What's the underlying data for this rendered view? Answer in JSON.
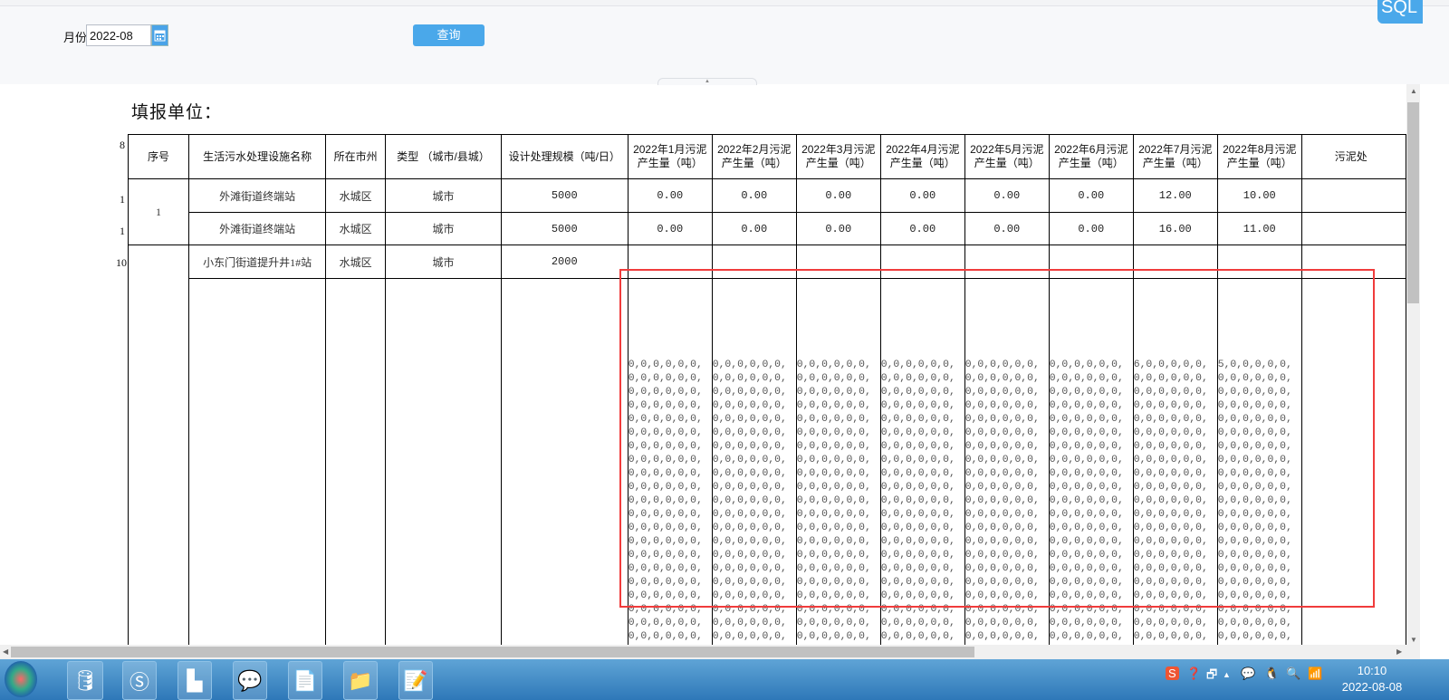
{
  "filter": {
    "month_label": "月份",
    "month_value": "2022-08",
    "query_label": "查询",
    "sql_label": "SQL"
  },
  "report": {
    "title": "填报单位："
  },
  "row_numbers": [
    "8",
    "1",
    "1",
    "10"
  ],
  "table": {
    "headers": [
      "序号",
      "生活污水处理设施名称",
      "所在市州",
      "类型 （城市/县城）",
      "设计处理规模（吨/日）",
      "2022年1月污泥产生量（吨）",
      "2022年2月污泥产生量（吨）",
      "2022年3月污泥产生量（吨）",
      "2022年4月污泥产生量（吨）",
      "2022年5月污泥产生量（吨）",
      "2022年6月污泥产生量（吨）",
      "2022年7月污泥产生量（吨）",
      "2022年8月污泥产生量（吨）",
      "污泥处"
    ],
    "group_seq": "1",
    "rows": [
      {
        "name": "外滩街道终端站",
        "city": "水城区",
        "type": "城市",
        "scale": "5000",
        "months": [
          "0.00",
          "0.00",
          "0.00",
          "0.00",
          "0.00",
          "0.00",
          "12.00",
          "10.00"
        ]
      },
      {
        "name": "外滩街道终端站",
        "city": "水城区",
        "type": "城市",
        "scale": "5000",
        "months": [
          "0.00",
          "0.00",
          "0.00",
          "0.00",
          "0.00",
          "0.00",
          "16.00",
          "11.00"
        ]
      },
      {
        "name": "小东门街道提升井1#站",
        "city": "水城区",
        "type": "城市",
        "scale": "2000",
        "months": [
          "",
          "",
          "",
          "",
          "",
          "",
          "",
          ""
        ]
      }
    ],
    "overflow_first_values": [
      "0",
      "0",
      "0",
      "0",
      "0",
      "0",
      "6",
      "5"
    ],
    "overflow_repeat_value": "0"
  },
  "taskbar": {
    "apps": [
      "db-tool",
      "sogou-browser",
      "feishu",
      "wechat",
      "notepad",
      "file-archive",
      "notepad-plus-plus"
    ],
    "clock_time": "10:10",
    "clock_date": "2022-08-08"
  },
  "colors": {
    "accent": "#4aa8ea",
    "highlight_box": "#f03c3c"
  }
}
